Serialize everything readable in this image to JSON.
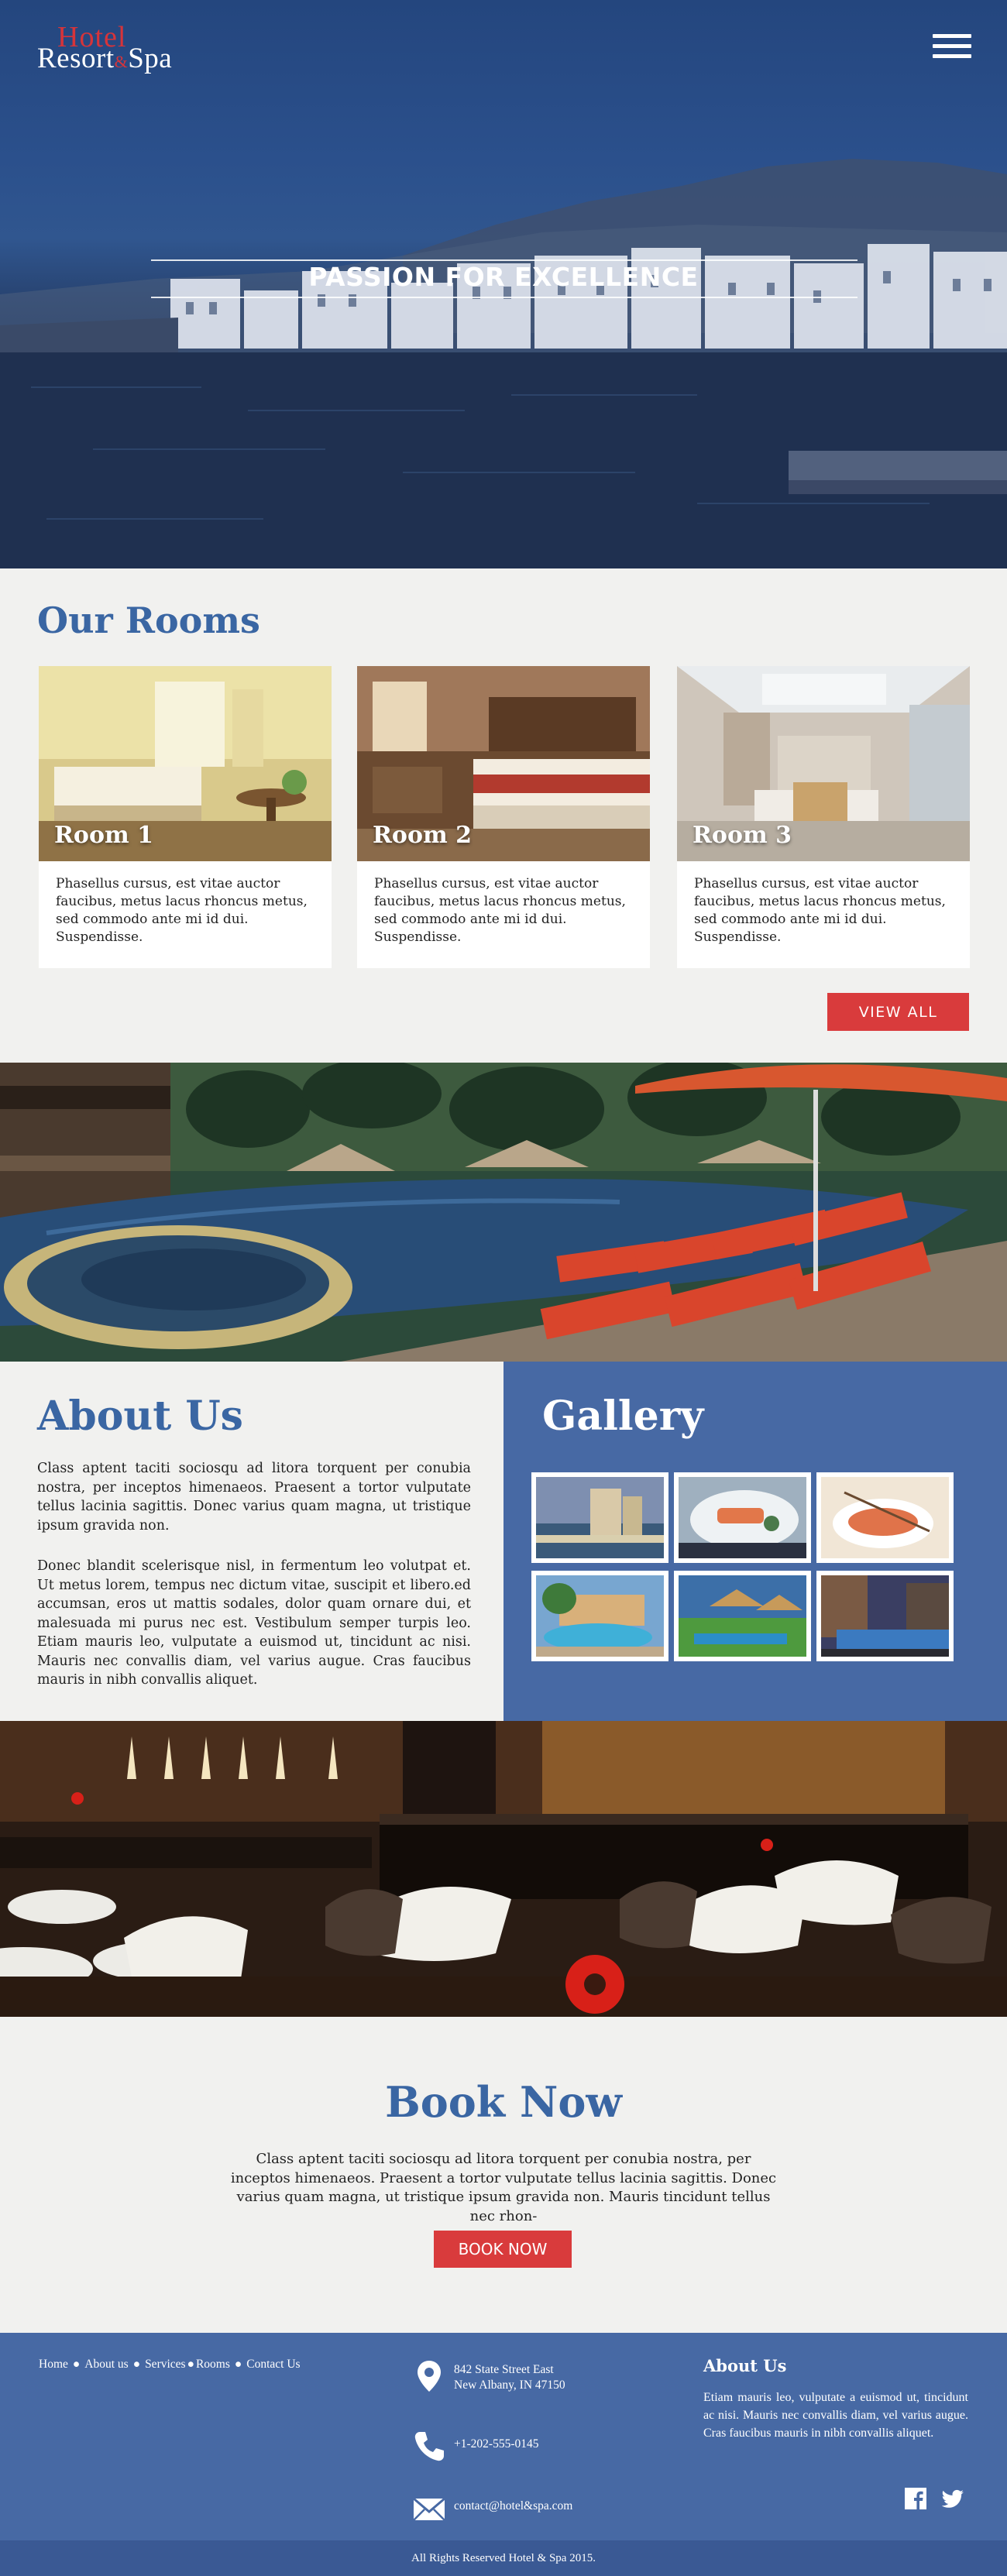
{
  "header": {
    "logo_line1": "Hotel",
    "logo_line2_a": "Resort",
    "logo_line2_amp": "&",
    "logo_line2_b": "Spa",
    "tagline": "PASSION FOR EXCELLENCE",
    "menu_icon": "hamburger-icon"
  },
  "rooms": {
    "title": "Our Rooms",
    "cards": [
      {
        "name": "Room 1",
        "text": "Phasellus cursus, est vitae auctor faucibus, metus lacus rhoncus metus, sed commodo ante mi id dui. Suspendisse."
      },
      {
        "name": "Room 2",
        "text": "Phasellus cursus, est vitae auctor faucibus, metus lacus rhoncus metus, sed commodo ante mi id dui. Suspendisse."
      },
      {
        "name": "Room 3",
        "text": "Phasellus cursus, est vitae auctor faucibus, metus lacus rhoncus metus, sed commodo ante mi id dui. Suspendisse."
      }
    ],
    "view_all_label": "VIEW ALL"
  },
  "about": {
    "title": "About Us",
    "para1": "Class aptent taciti sociosqu ad litora torquent per conubia nostra, per inceptos himenaeos. Praesent a tortor vulputate tellus lacinia sagittis. Donec varius quam magna, ut tristique ipsum gravida non.",
    "para2": "Donec blandit scelerisque nisl, in fermentum leo volutpat et. Ut metus lorem, tempus nec dictum vitae, suscipit et libero.ed accumsan, eros ut mattis sodales, dolor quam ornare dui, et malesuada mi purus nec est. Vestibulum semper turpis leo. Etiam mauris leo, vulputate a euismod ut, tincidunt ac nisi. Mauris nec convallis diam, vel varius augue. Cras faucibus mauris in nibh convallis aliquet."
  },
  "gallery": {
    "title": "Gallery"
  },
  "book": {
    "title": "Book Now",
    "text": "Class aptent taciti sociosqu ad litora torquent per conubia nostra, per inceptos himenaeos. Praesent a tortor vulputate tellus lacinia sagittis. Donec varius quam magna, ut tristique ipsum gravida non. Mauris tincidunt tellus nec rhon-",
    "button_label": "BOOK NOW"
  },
  "footer": {
    "nav": [
      "Home",
      "About us",
      "Services",
      "Rooms",
      "Contact Us"
    ],
    "address_line1": "842 State Street East",
    "address_line2": "New Albany, IN 47150",
    "phone": "+1-202-555-0145",
    "email": "contact@hotel&spa.com",
    "about_title": "About Us",
    "about_text": "Etiam mauris leo, vulputate a euismod ut, tincidunt ac nisi. Mauris nec convallis diam, vel varius augue. Cras faucibus mauris in nibh convallis aliquet.",
    "copyright": "All Rights Reserved Hotel & Spa 2015."
  },
  "colors": {
    "brand_blue": "#4769a4",
    "title_blue": "#3a66a3",
    "accent_red": "#d93b3c",
    "page_bg": "#f1f1ef"
  }
}
